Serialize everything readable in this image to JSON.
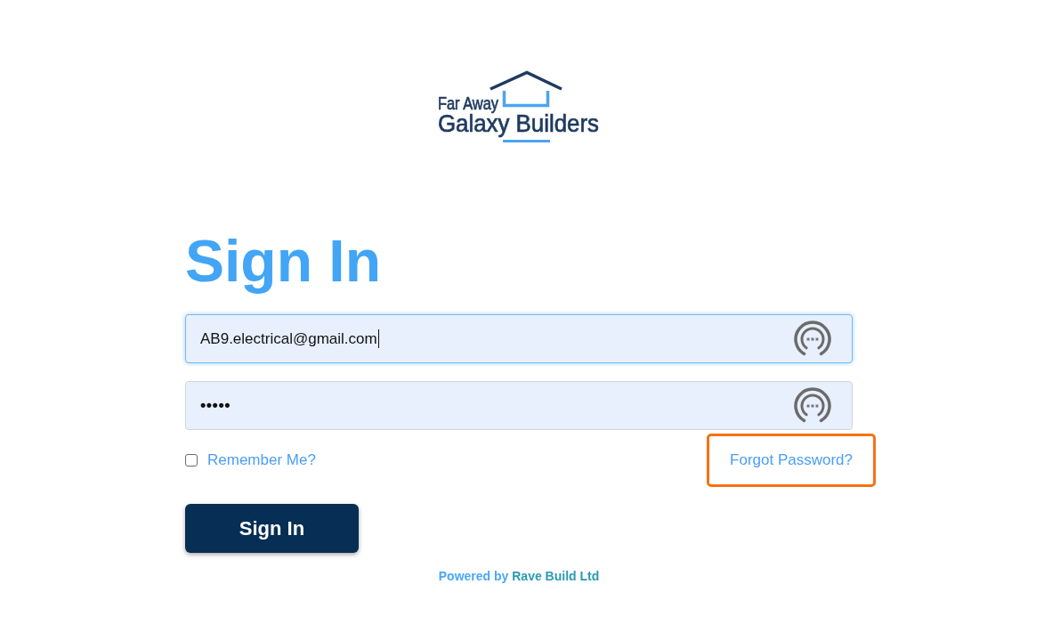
{
  "logo": {
    "lines": [
      "Far Away",
      "Galaxy Builders"
    ]
  },
  "heading": "Sign In",
  "fields": [
    {
      "kind": "email",
      "value": "AB9.electrical@gmail.com",
      "focused": true
    },
    {
      "kind": "password",
      "value": "•••••",
      "focused": false
    }
  ],
  "remember_me": {
    "label": "Remember Me?",
    "checked": false
  },
  "forgot_password": {
    "label": "Forgot Password?",
    "highlighted": true
  },
  "submit_button": "Sign In",
  "footer": {
    "prefix": "Powered by",
    "company": "Rave Build Ltd"
  }
}
